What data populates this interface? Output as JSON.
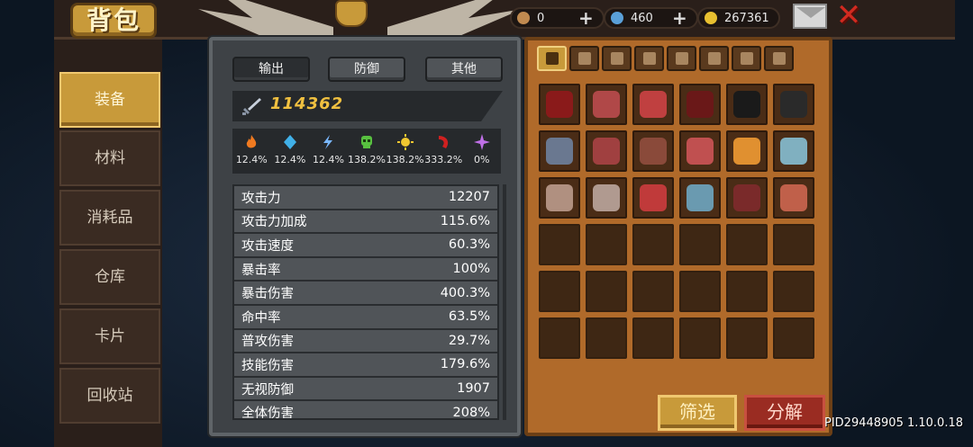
{
  "header": {
    "bag_title": "背包",
    "resources": [
      {
        "name": "bone",
        "value": "0",
        "color": "#c08a50"
      },
      {
        "name": "gem",
        "value": "460",
        "color": "#5aa0d8"
      },
      {
        "name": "gold",
        "value": "267361",
        "color": "#e8c030"
      }
    ]
  },
  "sidebar": {
    "tabs": [
      {
        "label": "装备",
        "active": true
      },
      {
        "label": "材料",
        "active": false
      },
      {
        "label": "消耗品",
        "active": false
      },
      {
        "label": "仓库",
        "active": false
      },
      {
        "label": "卡片",
        "active": false
      },
      {
        "label": "回收站",
        "active": false
      }
    ]
  },
  "stats_panel": {
    "tabs": [
      {
        "label": "输出",
        "active": true
      },
      {
        "label": "防御",
        "active": false
      },
      {
        "label": "其他",
        "active": false
      }
    ],
    "combat_power": "114362",
    "elements": [
      {
        "icon": "fire-icon",
        "value": "12.4%",
        "color": "#f07a20"
      },
      {
        "icon": "ice-icon",
        "value": "12.4%",
        "color": "#40b0e8"
      },
      {
        "icon": "lightning-icon",
        "value": "12.4%",
        "color": "#7ab8ff"
      },
      {
        "icon": "poison-icon",
        "value": "138.2%",
        "color": "#58c040"
      },
      {
        "icon": "light-icon",
        "value": "138.2%",
        "color": "#f0c830"
      },
      {
        "icon": "dark-icon",
        "value": "333.2%",
        "color": "#d02020"
      },
      {
        "icon": "arcane-icon",
        "value": "0%",
        "color": "#c070e8"
      }
    ],
    "rows": [
      {
        "label": "攻击力",
        "value": "12207"
      },
      {
        "label": "攻击力加成",
        "value": "115.6%"
      },
      {
        "label": "攻击速度",
        "value": "60.3%"
      },
      {
        "label": "暴击率",
        "value": "100%"
      },
      {
        "label": "暴击伤害",
        "value": "400.3%"
      },
      {
        "label": "命中率",
        "value": "63.5%"
      },
      {
        "label": "普攻伤害",
        "value": "29.7%"
      },
      {
        "label": "技能伤害",
        "value": "179.6%"
      },
      {
        "label": "无视防御",
        "value": "1907"
      },
      {
        "label": "全体伤害",
        "value": "208%"
      }
    ]
  },
  "inventory": {
    "categories": [
      "all-icon",
      "weapon-icon",
      "armor-icon",
      "helmet-icon",
      "pants-icon",
      "necklace-icon",
      "ring-icon",
      "gear-icon"
    ],
    "items": [
      {
        "icon": "dark-armor-icon",
        "color": "#8a1a1a"
      },
      {
        "icon": "wing-cape-icon",
        "color": "#b04848"
      },
      {
        "icon": "chest-plate-icon",
        "color": "#c04040"
      },
      {
        "icon": "dark-armor-icon",
        "color": "#6a1818"
      },
      {
        "icon": "shadow-armor-icon",
        "color": "#1a1a1a"
      },
      {
        "icon": "black-armor-icon",
        "color": "#2a2a2a"
      },
      {
        "icon": "boots-icon",
        "color": "#6a7890"
      },
      {
        "icon": "dragon-gauntlet-icon",
        "color": "#a04040"
      },
      {
        "icon": "boots-icon",
        "color": "#8a4a3a"
      },
      {
        "icon": "dragon-gauntlet-icon",
        "color": "#c05050"
      },
      {
        "icon": "amulet-icon",
        "color": "#e09030"
      },
      {
        "icon": "bowl-icon",
        "color": "#80b0c0"
      },
      {
        "icon": "shell-icon",
        "color": "#b09080"
      },
      {
        "icon": "shell-icon",
        "color": "#b09a90"
      },
      {
        "icon": "chest-plate-icon",
        "color": "#c03a3a"
      },
      {
        "icon": "bowl-icon",
        "color": "#6a9ab0"
      },
      {
        "icon": "bomb-icon",
        "color": "#7a2a2a"
      },
      {
        "icon": "ring-icon",
        "color": "#c0604a"
      }
    ],
    "empty_slots": 18,
    "filter_label": "筛选",
    "decompose_label": "分解"
  },
  "footer": {
    "pid": "PID29448905 1.10.0.18"
  }
}
